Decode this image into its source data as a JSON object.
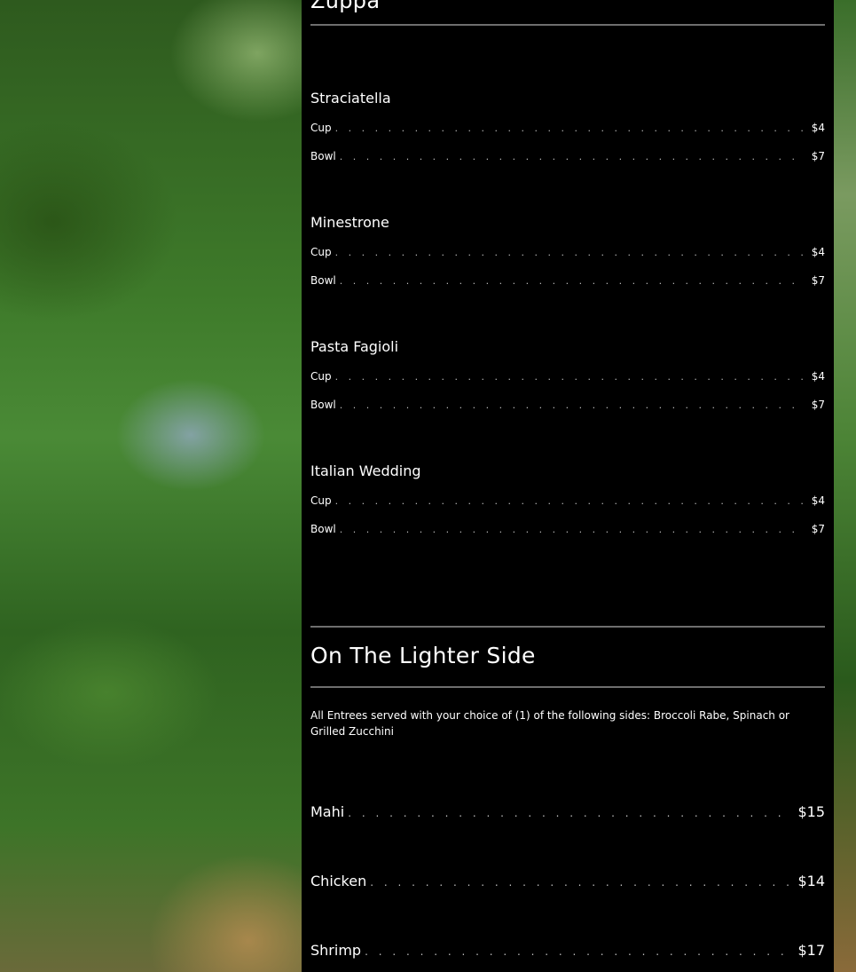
{
  "zuppa": {
    "title": "Zuppa",
    "items": [
      {
        "name": "Straciatella",
        "options": [
          {
            "label": "Cup",
            "price": "$4"
          },
          {
            "label": "Bowl",
            "price": "$7"
          }
        ]
      },
      {
        "name": "Minestrone",
        "options": [
          {
            "label": "Cup",
            "price": "$4"
          },
          {
            "label": "Bowl",
            "price": "$7"
          }
        ]
      },
      {
        "name": "Pasta Fagioli",
        "options": [
          {
            "label": "Cup",
            "price": "$4"
          },
          {
            "label": "Bowl",
            "price": "$7"
          }
        ]
      },
      {
        "name": "Italian Wedding",
        "options": [
          {
            "label": "Cup",
            "price": "$4"
          },
          {
            "label": "Bowl",
            "price": "$7"
          }
        ]
      }
    ]
  },
  "lighter": {
    "title": "On The Lighter Side",
    "note": "All Entrees served with your choice of (1) of the following sides: Broccoli Rabe, Spinach or Grilled Zucchini",
    "items": [
      {
        "name": "Mahi",
        "price": "$15"
      },
      {
        "name": "Chicken",
        "price": "$14"
      },
      {
        "name": "Shrimp",
        "price": "$17"
      }
    ]
  }
}
